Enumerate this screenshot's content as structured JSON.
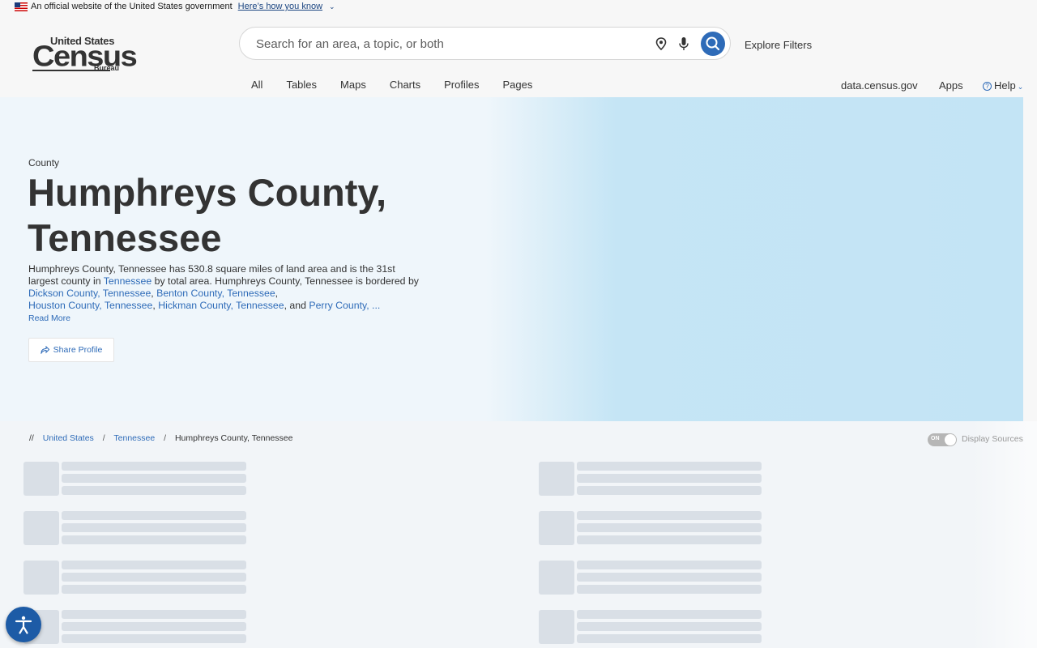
{
  "gov_banner": {
    "text": "An official website of the United States government",
    "link": "Here’s how you know"
  },
  "header": {
    "logo": {
      "line1": "United States",
      "line2": "Census",
      "line3": "Bureau"
    },
    "search_placeholder": "Search for an area, a topic, or both",
    "explore_filters": "Explore Filters",
    "nav": [
      "All",
      "Tables",
      "Maps",
      "Charts",
      "Profiles",
      "Pages"
    ],
    "right_nav": {
      "data_link": "data.census.gov",
      "apps": "Apps",
      "help": "Help"
    }
  },
  "hero": {
    "kind": "County",
    "title": "Humphreys County, Tennessee",
    "description": {
      "t1": "Humphreys County, Tennessee has 530.8 square miles of land area and is the 31st largest county in ",
      "l_tn": "Tennessee",
      "t2": " by total area. Humphreys County, Tennessee is bordered by ",
      "l1": "Dickson County, Tennessee",
      "c1": ", ",
      "l2": "Benton County, Tennessee",
      "c2": ", ",
      "l3": "Houston County, Tennessee",
      "c3": ", ",
      "l4": "Hickman County, Tennessee",
      "c4": ", and ",
      "l5": "Perry County, ..."
    },
    "read_more": "Read More",
    "share": "Share Profile"
  },
  "breadcrumb": {
    "prefix": "//",
    "items": [
      "United States",
      "Tennessee",
      "Humphreys County, Tennessee"
    ]
  },
  "sources_toggle": {
    "state": "ON",
    "label": "Display Sources"
  },
  "colors": {
    "accent": "#2e6bb8",
    "hero_light": "#eff6fb",
    "hero_blue": "#c3e4f5",
    "skeleton": "#d9dfe6"
  }
}
